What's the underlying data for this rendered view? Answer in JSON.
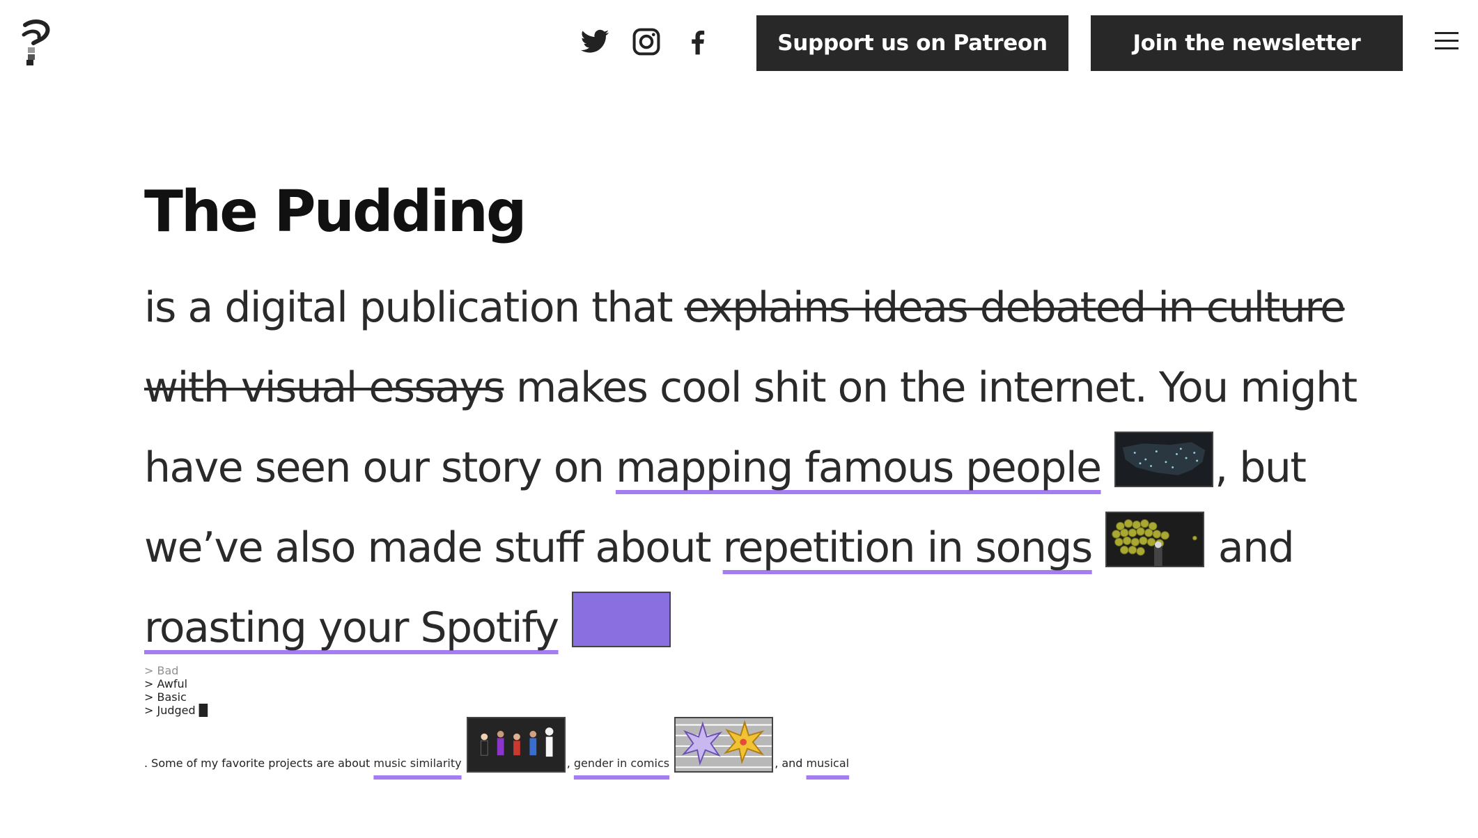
{
  "header": {
    "logo_icon": "pudding-logo-icon",
    "social_icons": [
      "twitter-icon",
      "instagram-icon",
      "facebook-icon"
    ],
    "patreon_button": "Support us on Patreon",
    "newsletter_button": "Join the newsletter",
    "menu_icon": "hamburger-menu-icon"
  },
  "main": {
    "title": "The Pudding",
    "intro": "is a digital publication that ",
    "struck_text": "explains ideas debated in culture with visual essays",
    "after_strike": " makes cool shit on the internet. You might have seen our story on ",
    "link_mapping": "mapping famous people",
    "text_2": ", but we’ve also made stuff about ",
    "link_repetition": "repetition in songs",
    "text_3": " and ",
    "link_spotify": "roasting your Spotify",
    "text_4": ". Some of my favorite projects are about ",
    "link_music": "music similarity",
    "text_5": ", ",
    "link_gender": "gender in comics",
    "text_6": ", and ",
    "link_musical": "musical",
    "spotify_thumb_lines": [
      "> Bad",
      "> Awful",
      "> Basic",
      "> Judged █"
    ]
  },
  "colors": {
    "link_underline": "#a57df2",
    "button_bg": "#282828",
    "text": "#2a2a2a"
  }
}
